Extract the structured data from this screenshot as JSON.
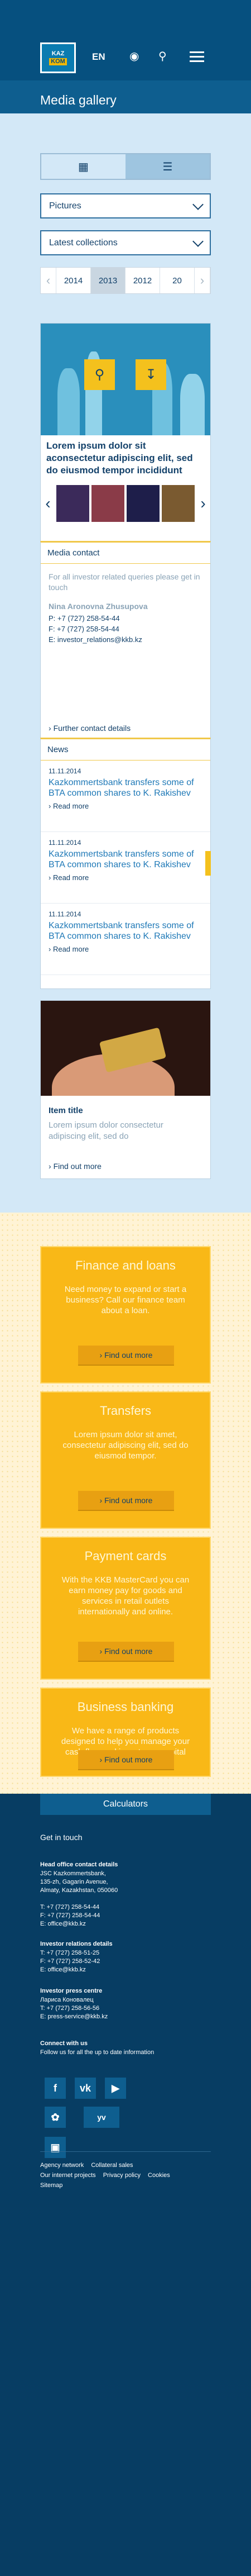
{
  "header": {
    "logo_top": "KAZ",
    "logo_bottom": "KOM",
    "lang": "EN",
    "title": "Media gallery"
  },
  "view_toggle": {
    "grid_icon": "grid-icon",
    "list_icon": "list-icon"
  },
  "filters": {
    "type": "Pictures",
    "collection": "Latest collections"
  },
  "years": [
    "2014",
    "2013",
    "2012",
    "20"
  ],
  "selected_year": "2013",
  "gallery": {
    "caption": "Lorem ipsum dolor sit aconsectetur adipiscing elit, sed do eiusmod tempor incididunt"
  },
  "media": {
    "title": "Media contact",
    "note": "For all investor related queries please get in touch",
    "name": "Nina Aronovna Zhusupova",
    "phone": "P: +7 (727) 258-54-44",
    "fax": "F: +7 (727) 258-54-44",
    "email": "E: investor_relations@kkb.kz",
    "more": "Further contact details"
  },
  "news": {
    "title": "News",
    "items": [
      {
        "date": "11.11.2014",
        "text": "Kazkommertsbank transfers some of BTA common shares to K. Rakishev",
        "more": "Read more"
      },
      {
        "date": "11.11.2014",
        "text": "Kazkommertsbank transfers some of BTA common shares to K. Rakishev",
        "more": "Read more"
      },
      {
        "date": "11.11.2014",
        "text": "Kazkommertsbank transfers some of BTA common shares to K. Rakishev",
        "more": "Read more"
      }
    ]
  },
  "item": {
    "title": "Item title",
    "desc": "Lorem ipsum dolor consectetur adipiscing elit, sed do",
    "more": "Find out more"
  },
  "promos": [
    {
      "title": "Finance and loans",
      "text": "Need money to expand or start a business? Call our finance team about a loan.",
      "btn": "Find out more"
    },
    {
      "title": "Transfers",
      "text": "Lorem ipsum dolor sit amet, consectetur adipiscing elit, sed do eiusmod tempor.",
      "btn": "Find out more"
    },
    {
      "title": "Payment cards",
      "text": "With the KKB MasterCard you can earn money pay for goods and services in retail outlets internationally and online.",
      "btn": "Find out more"
    },
    {
      "title": "Business banking",
      "text": "We have a range of products designed to help you manage your cash flow and invest your capital wisely",
      "btn": "Find out more"
    }
  ],
  "footer": {
    "calculators": "Calculators",
    "get_in_touch": "Get in touch",
    "head_title": "Head office contact details",
    "head_lines": [
      "JSC Kazkommertsbank,",
      "135-zh, Gagarin Avenue,",
      "Almaty, Kazakhstan, 050060",
      "",
      "T: +7 (727) 258-54-44",
      "F: +7 (727) 258-54-44",
      "E: office@kkb.kz"
    ],
    "inv_title": "Investor relations details",
    "inv_lines": [
      "T: +7 (727) 258-51-25",
      "F: +7 (727) 258-52-42",
      "E: office@kkb.kz"
    ],
    "press_title": "Investor press centre",
    "press_lines": [
      "Лариса Коновалец",
      "T: +7 (727) 258-56-56",
      "E: press-service@kkb.kz"
    ],
    "connect_title": "Connect with us",
    "connect_text": "Follow us for all the up to date information",
    "social": [
      "f",
      "vk",
      "yt",
      "tw",
      "yv",
      "ig"
    ],
    "links_row1": [
      "Agency network",
      "Collateral sales"
    ],
    "links_row2": [
      "Our internet projects",
      "Privacy policy",
      "Cookies"
    ],
    "links_row3": [
      "Sitemap"
    ]
  },
  "colors": {
    "header": "#06507f",
    "accent": "#f4c11d",
    "promo": "#f9b817",
    "footer": "#073d63"
  }
}
